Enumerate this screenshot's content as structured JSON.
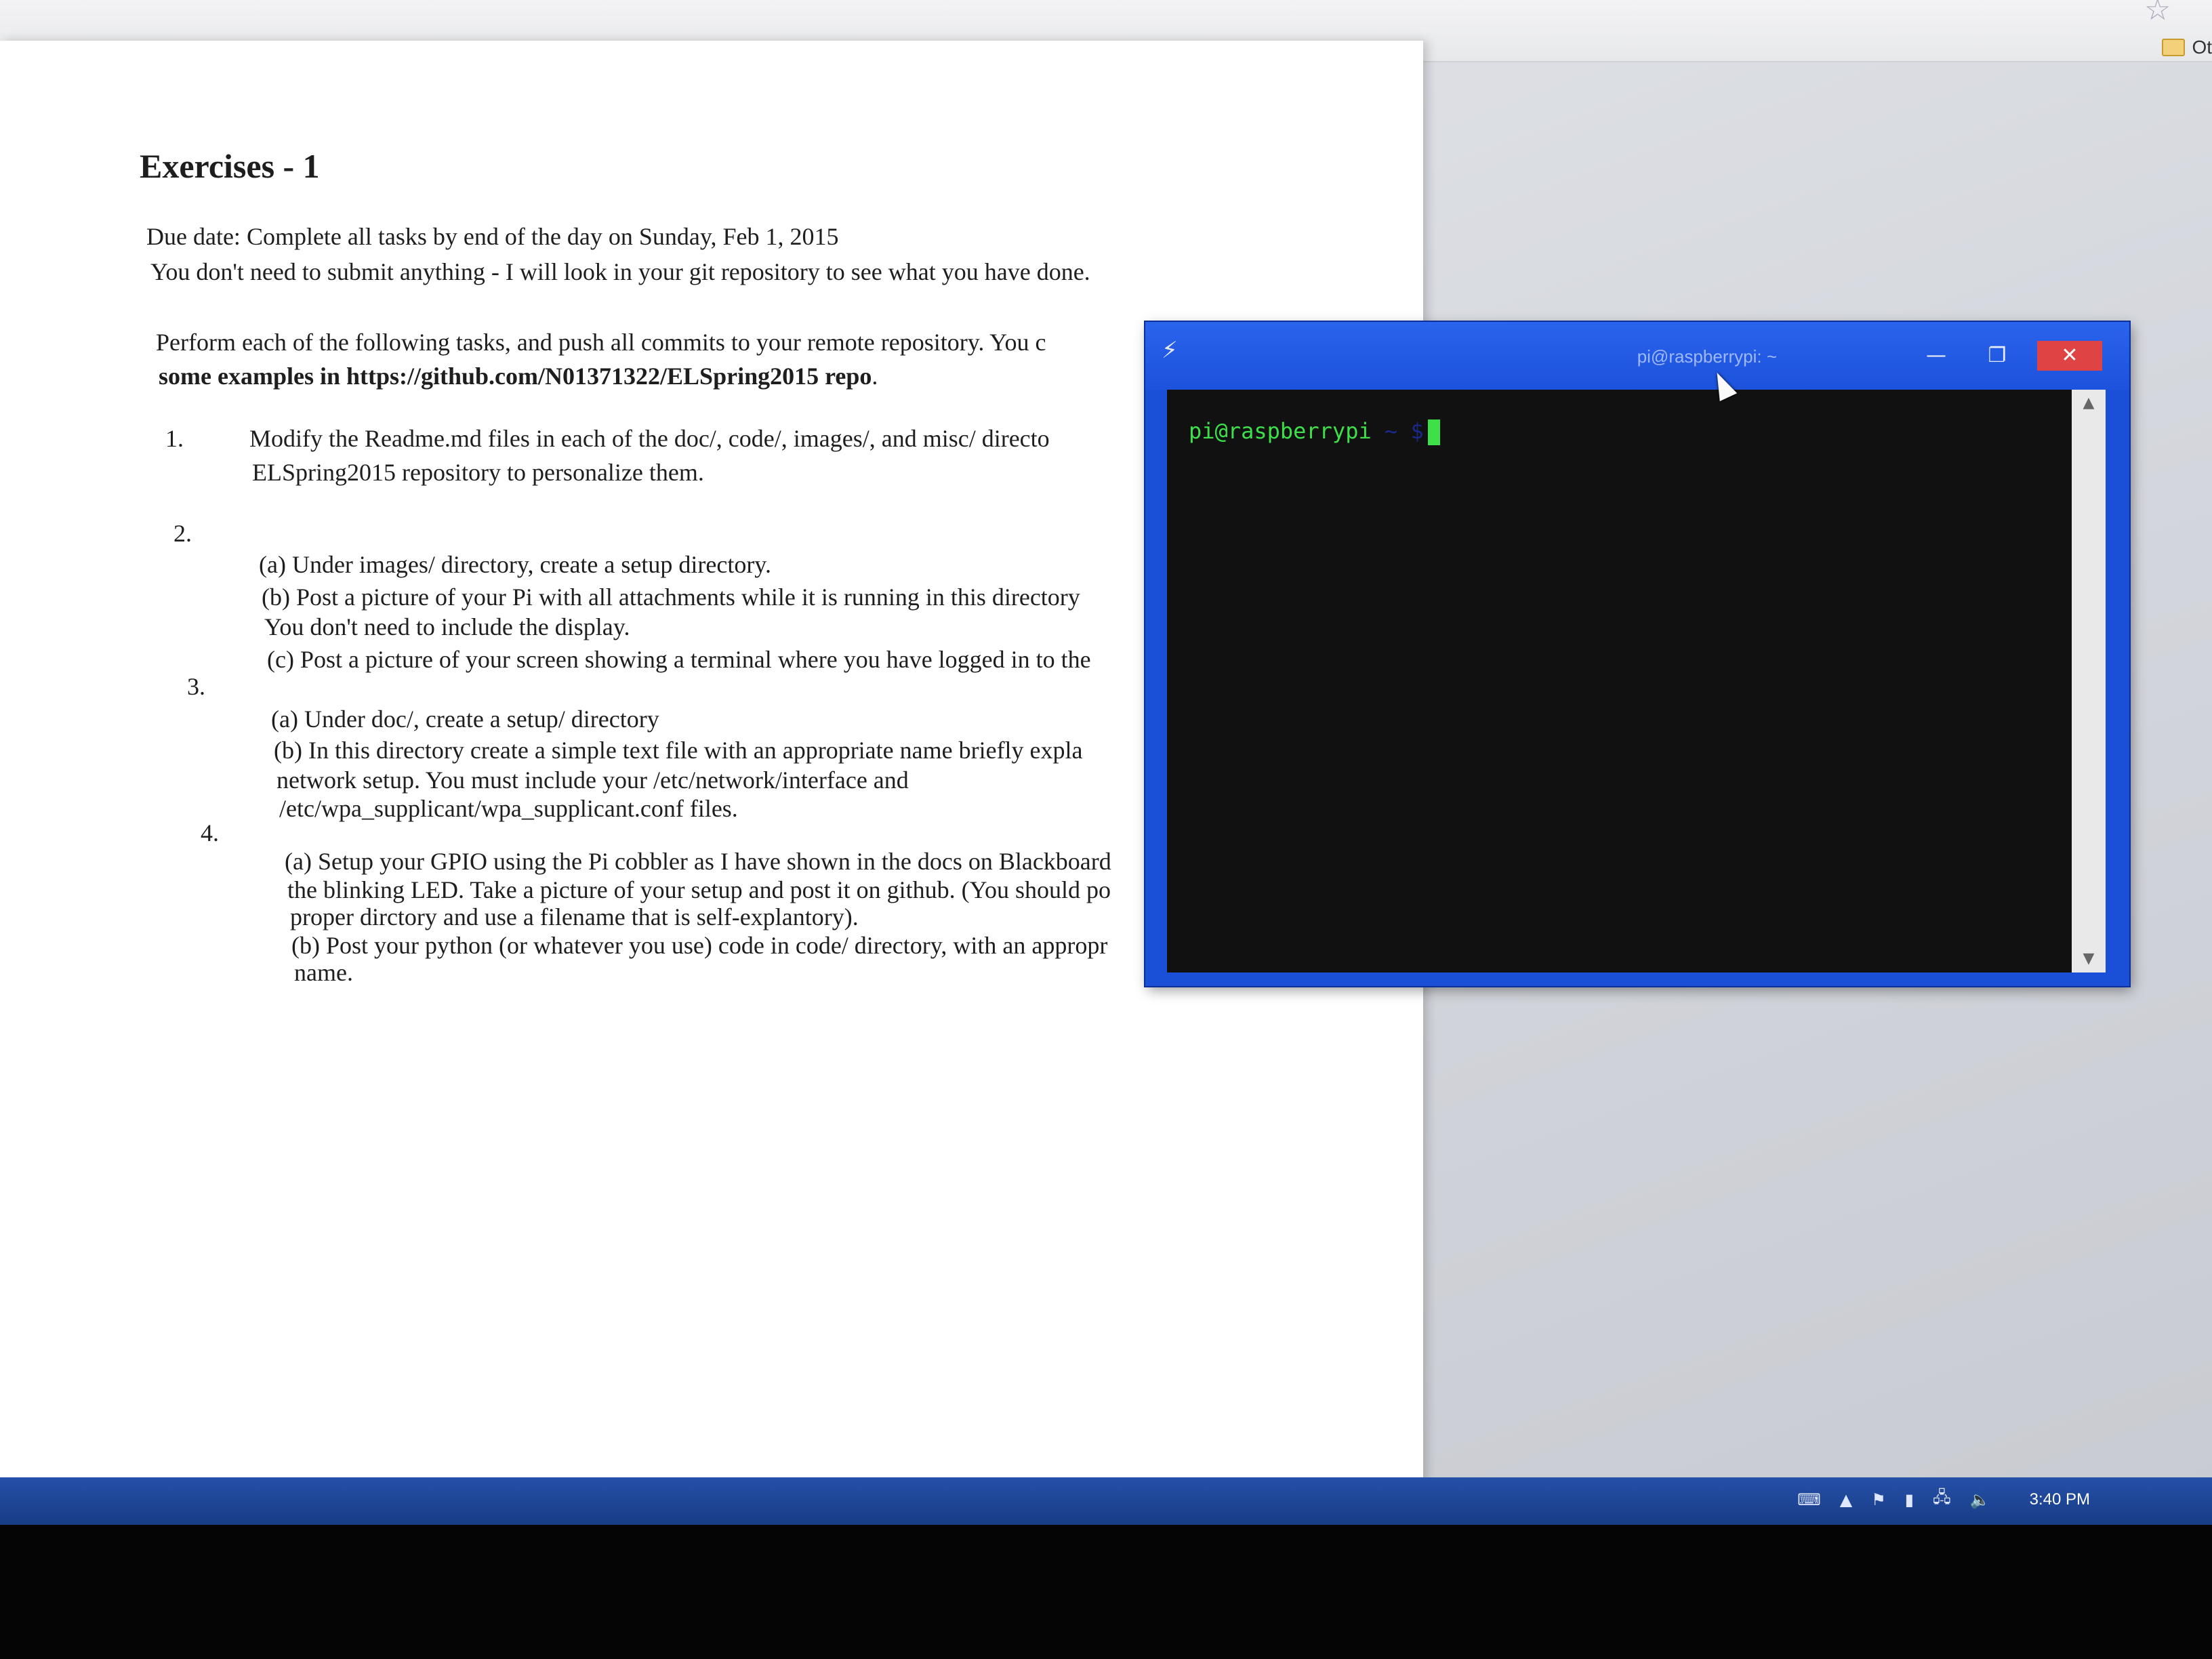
{
  "browser": {
    "star_icon": "star-icon",
    "bookmark_label": "Ot"
  },
  "document": {
    "title": "Exercises - 1",
    "due_line": "Due date: Complete all tasks by end of the day on Sunday, Feb 1, 2015",
    "submit_line": "You don't need to submit anything - I will look in your git repository to see what you have done.",
    "intro_line1": "Perform each of the following tasks, and push all commits to your remote repository. You c",
    "intro_line2_bold": "some examples in https://github.com/N01371322/ELSpring2015 repo",
    "intro_line2_end": ".",
    "items": [
      {
        "number": "1.",
        "lines": [
          "Modify the Readme.md files in each of the doc/,  code/,  images/, and  misc/ directo",
          "ELSpring2015 repository to personalize them."
        ]
      },
      {
        "number": "2.",
        "lines": [
          "(a) Under images/ directory, create a setup directory.",
          "(b) Post a picture of your Pi with all attachments while it is running in this directory",
          "You don't need to include the display.",
          "(c) Post a picture of your screen showing a terminal where you have logged in to the"
        ]
      },
      {
        "number": "3.",
        "lines": [
          "(a) Under doc/, create a setup/ directory",
          "(b) In this directory create a simple text file with an appropriate name  briefly expla",
          "network setup. You must include your /etc/network/interface and",
          "/etc/wpa_supplicant/wpa_supplicant.conf files."
        ]
      },
      {
        "number": "4.",
        "lines": [
          "(a) Setup your GPIO using the Pi cobbler as I have shown in the docs on Blackboard",
          "the blinking LED. Take a picture of your setup and post it on github. (You should po",
          "proper dirctory and use a filename that is self-explantory).",
          "(b) Post your python (or whatever you use) code in code/ directory, with an appropr",
          "name."
        ]
      }
    ]
  },
  "terminal": {
    "window_title": "pi@raspberrypi: ~",
    "app_icon": "putty-icon",
    "prompt": "pi@raspberrypi",
    "prompt_suffix": " ~ $",
    "close_glyph": "✕",
    "minimize_glyph": "—",
    "maximize_glyph": "❐",
    "scroll_up_glyph": "▲",
    "scroll_down_glyph": "▼"
  },
  "taskbar": {
    "clock": "3:40 PM",
    "tray_icons": [
      "keyboard-icon",
      "show-hidden-icon",
      "action-center-flag-icon",
      "power-icon",
      "network-icon",
      "volume-icon"
    ]
  }
}
